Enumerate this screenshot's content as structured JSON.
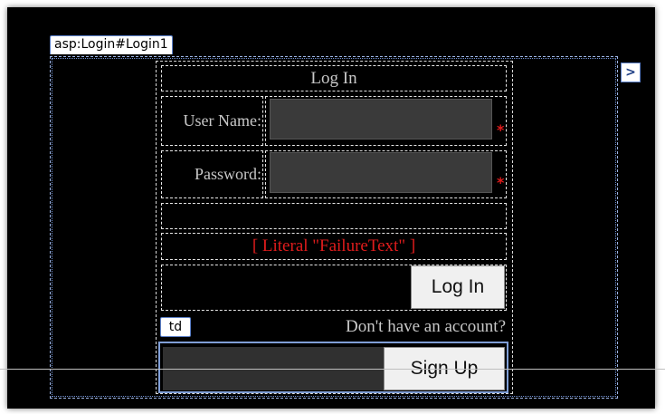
{
  "control_tag": "asp:Login#Login1",
  "smart_tag_glyph": ">",
  "login": {
    "title": "Log In",
    "username_label": "User Name:",
    "password_label": "Password:",
    "required_marker": "*",
    "failure_text": "[ Literal \"FailureText\" ]",
    "login_button": "Log In"
  },
  "cell_tag": "td",
  "signup": {
    "prompt": "Don't have an account?",
    "button": "Sign Up"
  },
  "colors": {
    "surface": "#000000",
    "label_text": "#c8c8c8",
    "failure_text": "#e01c1c",
    "selection_border": "#5b7fc7",
    "textbox_fill": "#3a3a3a"
  }
}
